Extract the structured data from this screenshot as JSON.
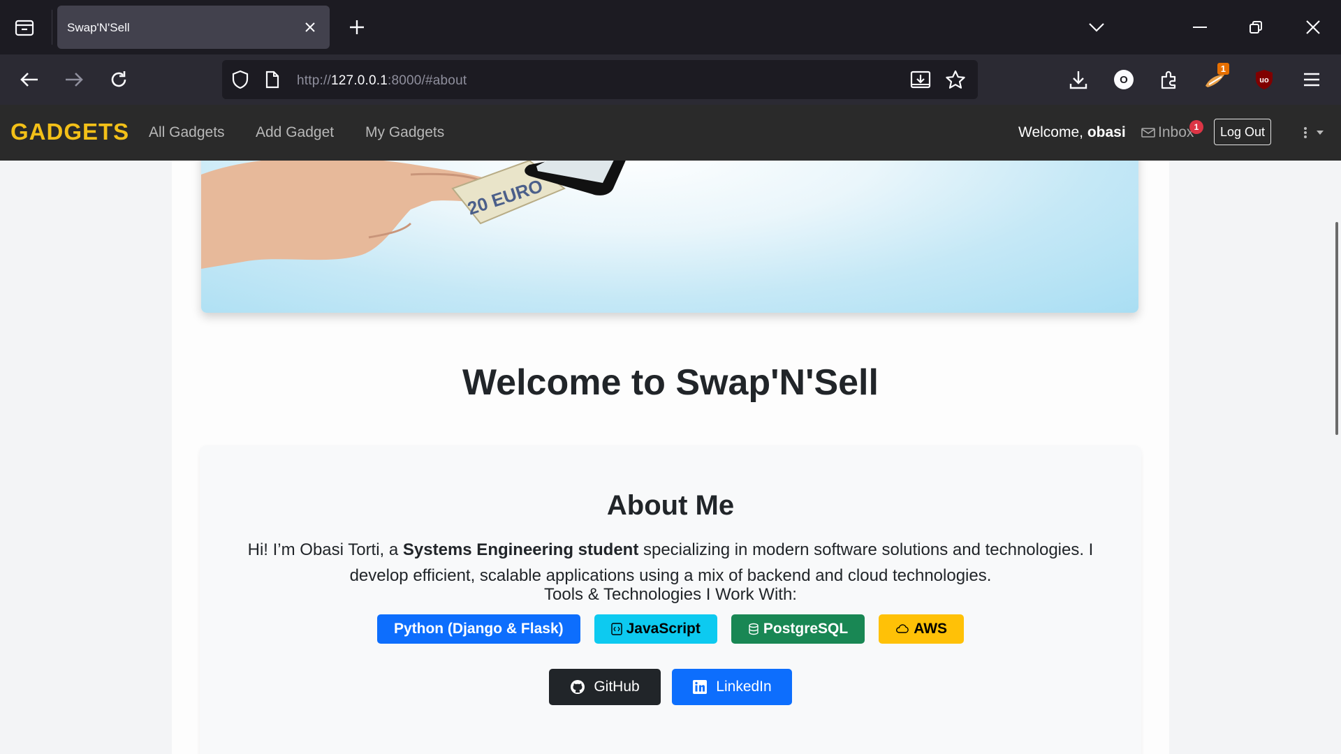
{
  "browser": {
    "tab_title": "Swap'N'Sell",
    "url_prefix": "http://",
    "url_host": "127.0.0.1",
    "url_rest": ":8000/#about",
    "account_initial": "O",
    "extension_badge": "1"
  },
  "site": {
    "brand": "GADGETS",
    "nav": [
      "All Gadgets",
      "Add Gadget",
      "My Gadgets"
    ],
    "welcome_prefix": "Welcome, ",
    "username": "obasi",
    "inbox_label": "Inbox",
    "inbox_count": "1",
    "logout_label": "Log Out"
  },
  "hero": {
    "banknote_label": "20 EURO"
  },
  "page": {
    "welcome_title": "Welcome to Swap'N'Sell"
  },
  "about": {
    "title": "About Me",
    "text_before": "Hi! I’m Obasi Torti, a ",
    "text_bold": "Systems Engineering student",
    "text_after": " specializing in modern software solutions and technologies. I develop efficient, scalable applications using a mix of backend and cloud technologies.",
    "tools_label": "Tools & Technologies I Work With:",
    "tools": [
      {
        "label": "Python (Django & Flask)",
        "icon": "",
        "bg": "#0d6efd",
        "fg": "#ffffff"
      },
      {
        "label": "JavaScript",
        "icon": "code-square-icon",
        "bg": "#0dcaf0",
        "fg": "#000000"
      },
      {
        "label": "PostgreSQL",
        "icon": "database-icon",
        "bg": "#198754",
        "fg": "#ffffff"
      },
      {
        "label": "AWS",
        "icon": "cloud-icon",
        "bg": "#ffc107",
        "fg": "#000000"
      }
    ],
    "github_label": "GitHub",
    "linkedin_label": "LinkedIn"
  },
  "colors": {
    "brand": "#f3c018",
    "github_bg": "#212529",
    "linkedin_bg": "#0d6efd"
  }
}
